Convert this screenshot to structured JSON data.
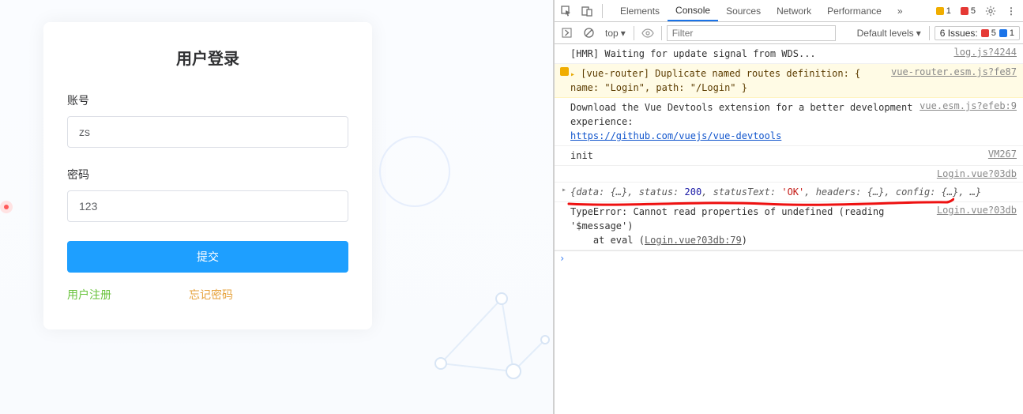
{
  "form": {
    "title": "用户登录",
    "account_label": "账号",
    "account_value": "zs",
    "password_label": "密码",
    "password_value": "123",
    "submit_label": "提交",
    "register_label": "用户注册",
    "forgot_label": "忘记密码"
  },
  "devtools": {
    "tabs": [
      "Elements",
      "Console",
      "Sources",
      "Network",
      "Performance"
    ],
    "active_tab": "Console",
    "more_tabs_indicator": "»",
    "top_warn_count": "1",
    "top_err_count": "5",
    "context_label": "top",
    "default_levels_label": "Default levels",
    "filter_placeholder": "Filter",
    "issues_label": "6 Issues:",
    "issues_err": "5",
    "issues_info": "1",
    "rows": [
      {
        "kind": "plain",
        "msg": "[HMR] Waiting for update signal from WDS...",
        "source": "log.js?4244"
      },
      {
        "kind": "warn",
        "msg": "[vue-router] Duplicate named routes definition: { name: \"Login\", path: \"/Login\" }",
        "source": "vue-router.esm.js?fe87"
      },
      {
        "kind": "plain",
        "msg": "Download the Vue Devtools extension for a better development experience:\n",
        "link": "https://github.com/vuejs/vue-devtools",
        "source": "vue.esm.js?efeb:9"
      },
      {
        "kind": "plain",
        "msg": "init",
        "source": "VM267"
      },
      {
        "kind": "srconly",
        "source": "Login.vue?03db"
      },
      {
        "kind": "object",
        "msg": "{data: {…}, status: 200, statusText: 'OK', headers: {…}, config: {…}, …}"
      },
      {
        "kind": "error",
        "msg": "TypeError: Cannot read properties of undefined (reading '$message')\n    at eval (",
        "inline_src": "Login.vue?03db:79",
        "tail": ")",
        "source": "Login.vue?03db"
      }
    ]
  }
}
